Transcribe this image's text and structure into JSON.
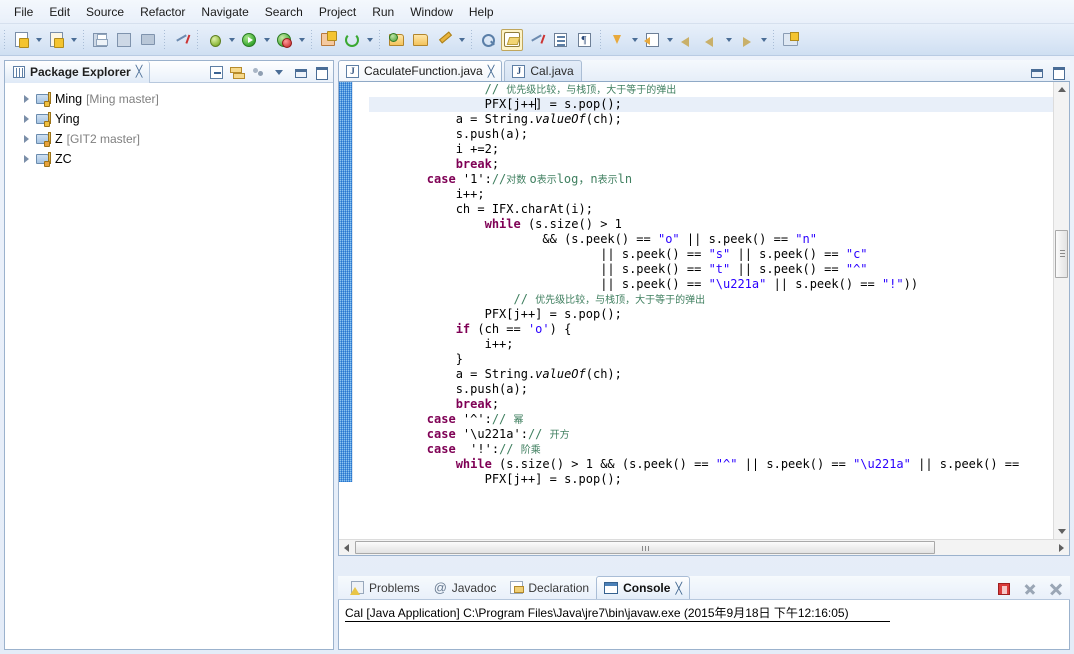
{
  "window": {
    "title": "Eclipse IDE"
  },
  "menubar": {
    "items": [
      {
        "label": "File"
      },
      {
        "label": "Edit"
      },
      {
        "label": "Source"
      },
      {
        "label": "Refactor"
      },
      {
        "label": "Navigate"
      },
      {
        "label": "Search"
      },
      {
        "label": "Project"
      },
      {
        "label": "Run"
      },
      {
        "label": "Window"
      },
      {
        "label": "Help"
      }
    ]
  },
  "toolbar": {
    "buttons": [
      {
        "name": "new-wizard",
        "icon": "new-document-icon",
        "has_dropdown": true
      },
      {
        "name": "new-java-package",
        "icon": "new-package-icon",
        "has_dropdown": true
      },
      {
        "name": "save",
        "icon": "save-icon",
        "has_dropdown": false
      },
      {
        "name": "save-all",
        "icon": "save-all-icon",
        "has_dropdown": false
      },
      {
        "name": "print",
        "icon": "print-icon",
        "has_dropdown": false
      },
      {
        "name": "toggle-mark-occurrences",
        "icon": "mark-occurrences-icon",
        "has_dropdown": false
      },
      {
        "name": "debug",
        "icon": "debug-bug-icon",
        "has_dropdown": true
      },
      {
        "name": "run",
        "icon": "run-green-play-icon",
        "has_dropdown": true
      },
      {
        "name": "run-external-tools",
        "icon": "external-tools-icon",
        "has_dropdown": true
      },
      {
        "name": "new-java-class",
        "icon": "new-class-icon",
        "has_dropdown": false
      },
      {
        "name": "refresh",
        "icon": "refresh-circular-arrow-icon",
        "has_dropdown": true
      },
      {
        "name": "open-type",
        "icon": "open-type-folder-icon",
        "has_dropdown": false
      },
      {
        "name": "open-task",
        "icon": "open-task-folder-icon",
        "has_dropdown": false
      },
      {
        "name": "quick-fix",
        "icon": "pencil-icon",
        "has_dropdown": true
      },
      {
        "name": "search",
        "icon": "search-icon",
        "has_dropdown": false
      },
      {
        "name": "highlight-toggle",
        "icon": "marker-highlight-icon",
        "has_dropdown": false,
        "pressed": true
      },
      {
        "name": "skip-breakpoints",
        "icon": "skip-breakpoints-icon",
        "has_dropdown": false
      },
      {
        "name": "show-outline",
        "icon": "outline-icon",
        "has_dropdown": false
      },
      {
        "name": "show-whitespace",
        "icon": "pilcrow-icon",
        "has_dropdown": false,
        "glyph": "¶"
      },
      {
        "name": "next-annotation",
        "icon": "next-annotation-down-icon",
        "has_dropdown": true
      },
      {
        "name": "previous-annotation",
        "icon": "previous-annotation-icon",
        "has_dropdown": true
      },
      {
        "name": "back",
        "icon": "arrow-left-icon",
        "has_dropdown": false
      },
      {
        "name": "back-history",
        "icon": "arrow-left-icon",
        "has_dropdown": true
      },
      {
        "name": "forward",
        "icon": "arrow-right-icon",
        "has_dropdown": true
      },
      {
        "name": "open-perspective",
        "icon": "open-perspective-icon",
        "has_dropdown": false
      }
    ]
  },
  "explorer": {
    "tab": {
      "label": "Package Explorer",
      "close_glyph": "╳",
      "icon": "package-explorer-icon"
    },
    "toolbar": [
      {
        "name": "collapse-all",
        "icon": "collapse-all-icon"
      },
      {
        "name": "link-with-editor",
        "icon": "link-editor-icon"
      },
      {
        "name": "focus-on-active-task",
        "icon": "focus-task-icon"
      },
      {
        "name": "view-menu",
        "icon": "chevron-down-icon"
      },
      {
        "name": "minimize-view",
        "icon": "minimize-icon"
      },
      {
        "name": "maximize-view",
        "icon": "maximize-icon"
      }
    ],
    "tree": [
      {
        "name": "Ming",
        "meta": "[Ming master]",
        "expanded": false,
        "icon": "java-project-icon"
      },
      {
        "name": "Ying",
        "meta": "",
        "expanded": false,
        "icon": "java-project-icon"
      },
      {
        "name": "Z",
        "meta": "[GIT2 master]",
        "expanded": false,
        "icon": "java-project-repo-icon"
      },
      {
        "name": "ZC",
        "meta": "",
        "expanded": false,
        "icon": "java-project-repo-icon"
      }
    ]
  },
  "editor": {
    "tabs": [
      {
        "label": "CaculateFunction.java",
        "active": true,
        "icon": "java-file-icon",
        "close_glyph": "╳"
      },
      {
        "label": "Cal.java",
        "active": false,
        "icon": "java-file-icon",
        "close_glyph": ""
      }
    ],
    "controls": [
      {
        "name": "minimize-editor",
        "icon": "minimize-icon"
      },
      {
        "name": "maximize-editor",
        "icon": "maximize-icon"
      }
    ],
    "code_lines": [
      {
        "indent": 16,
        "current": false,
        "tokens": [
          {
            "t": "// ",
            "c": "cmt"
          },
          {
            "t": "优先级比较，与栈顶，大于等于的弹出",
            "c": "cmt-cjk"
          }
        ]
      },
      {
        "indent": 16,
        "current": true,
        "tokens": [
          {
            "t": "PFX[j++",
            "c": ""
          },
          {
            "t": "|",
            "c": "caret"
          },
          {
            "t": "] = s.pop();",
            "c": ""
          }
        ]
      },
      {
        "indent": 12,
        "current": false,
        "tokens": [
          {
            "t": "a = String.",
            "c": ""
          },
          {
            "t": "valueOf",
            "c": "ital"
          },
          {
            "t": "(ch);",
            "c": ""
          }
        ]
      },
      {
        "indent": 12,
        "current": false,
        "tokens": [
          {
            "t": "s.push(a);",
            "c": ""
          }
        ]
      },
      {
        "indent": 12,
        "current": false,
        "tokens": [
          {
            "t": "i +=2;",
            "c": ""
          }
        ]
      },
      {
        "indent": 12,
        "current": false,
        "tokens": [
          {
            "t": "break",
            "c": "kw"
          },
          {
            "t": ";",
            "c": ""
          }
        ]
      },
      {
        "indent": 8,
        "current": false,
        "tokens": [
          {
            "t": "case",
            "c": "kw"
          },
          {
            "t": " '1':",
            "c": ""
          },
          {
            "t": "//",
            "c": "cmt"
          },
          {
            "t": "对数 ",
            "c": "cmt-cjk"
          },
          {
            "t": "o",
            "c": "cmt"
          },
          {
            "t": "表示",
            "c": "cmt-cjk"
          },
          {
            "t": "log，n",
            "c": "cmt"
          },
          {
            "t": "表示",
            "c": "cmt-cjk"
          },
          {
            "t": "ln",
            "c": "cmt"
          }
        ]
      },
      {
        "indent": 12,
        "current": false,
        "tokens": [
          {
            "t": "i++;",
            "c": ""
          }
        ]
      },
      {
        "indent": 12,
        "current": false,
        "tokens": [
          {
            "t": "ch = IFX.charAt(i);",
            "c": ""
          }
        ]
      },
      {
        "indent": 16,
        "current": false,
        "tokens": [
          {
            "t": "while",
            "c": "kw"
          },
          {
            "t": " (s.size() > 1",
            "c": ""
          }
        ]
      },
      {
        "indent": 24,
        "current": false,
        "tokens": [
          {
            "t": "&& (s.peek() == ",
            "c": ""
          },
          {
            "t": "\"o\"",
            "c": "str"
          },
          {
            "t": " || s.peek() == ",
            "c": ""
          },
          {
            "t": "\"n\"",
            "c": "str"
          }
        ]
      },
      {
        "indent": 32,
        "current": false,
        "tokens": [
          {
            "t": "|| s.peek() == ",
            "c": ""
          },
          {
            "t": "\"s\"",
            "c": "str"
          },
          {
            "t": " || s.peek() == ",
            "c": ""
          },
          {
            "t": "\"c\"",
            "c": "str"
          }
        ]
      },
      {
        "indent": 32,
        "current": false,
        "tokens": [
          {
            "t": "|| s.peek() == ",
            "c": ""
          },
          {
            "t": "\"t\"",
            "c": "str"
          },
          {
            "t": " || s.peek() == ",
            "c": ""
          },
          {
            "t": "\"^\"",
            "c": "str"
          }
        ]
      },
      {
        "indent": 32,
        "current": false,
        "tokens": [
          {
            "t": "|| s.peek() == ",
            "c": ""
          },
          {
            "t": "\"\\u221a\"",
            "c": "str"
          },
          {
            "t": " || s.peek() == ",
            "c": ""
          },
          {
            "t": "\"!\"",
            "c": "str"
          },
          {
            "t": "))",
            "c": ""
          }
        ]
      },
      {
        "indent": 20,
        "current": false,
        "tokens": [
          {
            "t": "// ",
            "c": "cmt"
          },
          {
            "t": "优先级比较，与栈顶，大于等于的弹出",
            "c": "cmt-cjk"
          }
        ]
      },
      {
        "indent": 16,
        "current": false,
        "tokens": [
          {
            "t": "PFX[j++] = s.pop();",
            "c": ""
          }
        ]
      },
      {
        "indent": 12,
        "current": false,
        "tokens": [
          {
            "t": "if",
            "c": "kw"
          },
          {
            "t": " (ch == ",
            "c": ""
          },
          {
            "t": "'o'",
            "c": "str"
          },
          {
            "t": ") {",
            "c": ""
          }
        ]
      },
      {
        "indent": 16,
        "current": false,
        "tokens": [
          {
            "t": "i++;",
            "c": ""
          }
        ]
      },
      {
        "indent": 12,
        "current": false,
        "tokens": [
          {
            "t": "}",
            "c": ""
          }
        ]
      },
      {
        "indent": 12,
        "current": false,
        "tokens": [
          {
            "t": "a = String.",
            "c": ""
          },
          {
            "t": "valueOf",
            "c": "ital"
          },
          {
            "t": "(ch);",
            "c": ""
          }
        ]
      },
      {
        "indent": 12,
        "current": false,
        "tokens": [
          {
            "t": "s.push(a);",
            "c": ""
          }
        ]
      },
      {
        "indent": 12,
        "current": false,
        "tokens": [
          {
            "t": "break",
            "c": "kw"
          },
          {
            "t": ";",
            "c": ""
          }
        ]
      },
      {
        "indent": 8,
        "current": false,
        "tokens": [
          {
            "t": "case",
            "c": "kw"
          },
          {
            "t": " '^':",
            "c": ""
          },
          {
            "t": "// ",
            "c": "cmt"
          },
          {
            "t": "幂",
            "c": "cmt-cjk"
          }
        ]
      },
      {
        "indent": 8,
        "current": false,
        "tokens": [
          {
            "t": "case",
            "c": "kw"
          },
          {
            "t": " '\\u221a':",
            "c": ""
          },
          {
            "t": "// ",
            "c": "cmt"
          },
          {
            "t": "开方",
            "c": "cmt-cjk"
          }
        ]
      },
      {
        "indent": 8,
        "current": false,
        "tokens": [
          {
            "t": "case",
            "c": "kw"
          },
          {
            "t": "  '!':",
            "c": ""
          },
          {
            "t": "// ",
            "c": "cmt"
          },
          {
            "t": "阶乘",
            "c": "cmt-cjk"
          }
        ]
      },
      {
        "indent": 12,
        "current": false,
        "tokens": [
          {
            "t": "while",
            "c": "kw"
          },
          {
            "t": " (s.size() > 1 && (s.peek() == ",
            "c": ""
          },
          {
            "t": "\"^\"",
            "c": "str"
          },
          {
            "t": " || s.peek() == ",
            "c": ""
          },
          {
            "t": "\"\\u221a\"",
            "c": "str"
          },
          {
            "t": " || s.peek() ==",
            "c": ""
          }
        ]
      },
      {
        "indent": 16,
        "current": false,
        "tokens": [
          {
            "t": "PFX[j++] = s.pop();",
            "c": ""
          }
        ]
      }
    ]
  },
  "console": {
    "tabs": [
      {
        "label": "Problems",
        "active": false,
        "icon": "problems-icon"
      },
      {
        "label": "Javadoc",
        "active": false,
        "icon": "javadoc-at-icon"
      },
      {
        "label": "Declaration",
        "active": false,
        "icon": "declaration-icon"
      },
      {
        "label": "Console",
        "active": true,
        "icon": "console-icon",
        "close_glyph": "╳"
      }
    ],
    "toolbar": [
      {
        "name": "terminate",
        "icon": "terminate-stop-icon"
      },
      {
        "name": "remove-launch",
        "icon": "remove-launch-x-icon"
      },
      {
        "name": "remove-all-terminated",
        "icon": "remove-all-terminated-icon"
      }
    ],
    "output": "Cal [Java Application] C:\\Program Files\\Java\\jre7\\bin\\javaw.exe (2015年9月18日 下午12:16:05)"
  },
  "colors": {
    "keyword": "#7f0055",
    "string": "#2a00ff",
    "comment": "#3f7f5f",
    "current_line": "#e8eff9",
    "chrome": "#cfdff2"
  }
}
